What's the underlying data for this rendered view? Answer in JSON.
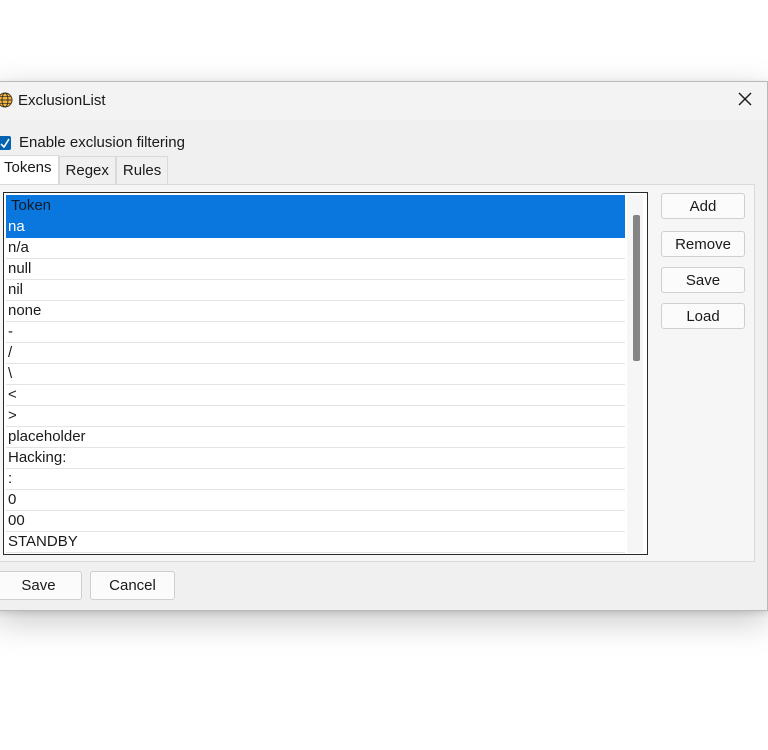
{
  "window": {
    "title": "ExclusionList"
  },
  "options": {
    "enable_label": "Enable exclusion filtering",
    "enable_checked": true
  },
  "tabs": [
    {
      "label": "Tokens",
      "active": true
    },
    {
      "label": "Regex",
      "active": false
    },
    {
      "label": "Rules",
      "active": false
    }
  ],
  "list": {
    "header": "Token",
    "items": [
      "na",
      "n/a",
      "null",
      "nil",
      "none",
      "-",
      "/",
      "\\",
      "<",
      ">",
      "placeholder",
      "Hacking:",
      ":",
      "0",
      "00",
      "STANDBY"
    ],
    "selected_index": 0
  },
  "side_buttons": {
    "add": "Add",
    "remove": "Remove",
    "save": "Save",
    "load": "Load"
  },
  "footer": {
    "save": "Save",
    "cancel": "Cancel"
  },
  "colors": {
    "selection": "#0a77de",
    "checkbox": "#0063b1"
  }
}
